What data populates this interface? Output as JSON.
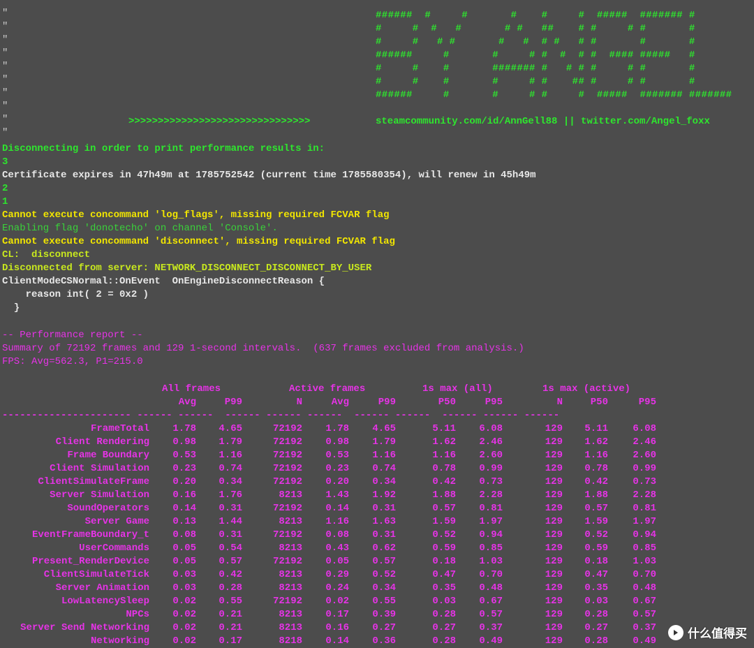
{
  "colors": {
    "background": "#4c4c4c",
    "green": "#2ee62e",
    "white": "#e8e8e8",
    "yellow": "#f2e600",
    "magenta": "#e633e6"
  },
  "banner": {
    "quote_char": "\"",
    "rows": [
      "######  #     #       #    #     #  #####  ####### #",
      "#     #  #   #       # #   ##    # #     # #       #",
      "#     #   # #       #   #  # #   # #       #       #",
      "######     #       #     # #  #  # #  #### #####   #",
      "#     #    #       ####### #   # # #     # #       #",
      "#     #    #       #     # #    ## #     # #       #",
      "######     #       #     # #     #  #####  ####### #######"
    ],
    "arrows": ">>>>>>>>>>>>>>>>>>>>>>>>>>>>>>>",
    "links": "steamcommunity.com/id/AnnGell88 || twitter.com/Angel_foxx"
  },
  "log": {
    "disconnecting": "Disconnecting in order to print performance results in:",
    "count3": "3",
    "certificate": "Certificate expires in 47h49m at 1785752542 (current time 1785580354), will renew in 45h49m",
    "count2": "2",
    "count1": "1",
    "cannot_log_flags": "Cannot execute concommand 'log_flags', missing required FCVAR flag",
    "enabling_flag": "Enabling flag 'donotecho' on channel 'Console'.",
    "cannot_disconnect": "Cannot execute concommand 'disconnect', missing required FCVAR flag",
    "cl_disconnect": "CL:  disconnect",
    "disconnected_from": "Disconnected from server: NETWORK_DISCONNECT_DISCONNECT_BY_USER",
    "client_mode": "ClientModeCSNormal::OnEvent  OnEngineDisconnectReason {",
    "reason": "    reason int( 2 = 0x2 )",
    "close_brace": "  }"
  },
  "performance": {
    "header": "-- Performance report --",
    "summary": "Summary of 72192 frames and 129 1-second intervals.  (637 frames excluded from analysis.)",
    "fps": "FPS: Avg=562.3, P1=215.0",
    "group_headers": {
      "all_frames": "All frames",
      "active_frames": "Active frames",
      "max_all": "1s max (all)",
      "max_active": "1s max (active)"
    },
    "columns": {
      "avg": "Avg",
      "p99": "P99",
      "n": "N",
      "avg2": "Avg",
      "p99_2": "P99",
      "p50": "P50",
      "p95": "P95",
      "n2": "N",
      "p50_2": "P50",
      "p95_2": "P95"
    },
    "rows": [
      [
        "FrameTotal",
        "1.78",
        "4.65",
        "72192",
        "1.78",
        "4.65",
        "5.11",
        "6.08",
        "129",
        "5.11",
        "6.08"
      ],
      [
        "Client Rendering",
        "0.98",
        "1.79",
        "72192",
        "0.98",
        "1.79",
        "1.62",
        "2.46",
        "129",
        "1.62",
        "2.46"
      ],
      [
        "Frame Boundary",
        "0.53",
        "1.16",
        "72192",
        "0.53",
        "1.16",
        "1.16",
        "2.60",
        "129",
        "1.16",
        "2.60"
      ],
      [
        "Client Simulation",
        "0.23",
        "0.74",
        "72192",
        "0.23",
        "0.74",
        "0.78",
        "0.99",
        "129",
        "0.78",
        "0.99"
      ],
      [
        "ClientSimulateFrame",
        "0.20",
        "0.34",
        "72192",
        "0.20",
        "0.34",
        "0.42",
        "0.73",
        "129",
        "0.42",
        "0.73"
      ],
      [
        "Server Simulation",
        "0.16",
        "1.76",
        "8213",
        "1.43",
        "1.92",
        "1.88",
        "2.28",
        "129",
        "1.88",
        "2.28"
      ],
      [
        "SoundOperators",
        "0.14",
        "0.31",
        "72192",
        "0.14",
        "0.31",
        "0.57",
        "0.81",
        "129",
        "0.57",
        "0.81"
      ],
      [
        "Server Game",
        "0.13",
        "1.44",
        "8213",
        "1.16",
        "1.63",
        "1.59",
        "1.97",
        "129",
        "1.59",
        "1.97"
      ],
      [
        "EventFrameBoundary_t",
        "0.08",
        "0.31",
        "72192",
        "0.08",
        "0.31",
        "0.52",
        "0.94",
        "129",
        "0.52",
        "0.94"
      ],
      [
        "UserCommands",
        "0.05",
        "0.54",
        "8213",
        "0.43",
        "0.62",
        "0.59",
        "0.85",
        "129",
        "0.59",
        "0.85"
      ],
      [
        "Present_RenderDevice",
        "0.05",
        "0.57",
        "72192",
        "0.05",
        "0.57",
        "0.18",
        "1.03",
        "129",
        "0.18",
        "1.03"
      ],
      [
        "ClientSimulateTick",
        "0.03",
        "0.42",
        "8213",
        "0.29",
        "0.52",
        "0.47",
        "0.70",
        "129",
        "0.47",
        "0.70"
      ],
      [
        "Server Animation",
        "0.03",
        "0.28",
        "8213",
        "0.24",
        "0.34",
        "0.35",
        "0.48",
        "129",
        "0.35",
        "0.48"
      ],
      [
        "LowLatencySleep",
        "0.02",
        "0.55",
        "72192",
        "0.02",
        "0.55",
        "0.03",
        "0.67",
        "129",
        "0.03",
        "0.67"
      ],
      [
        "NPCs",
        "0.02",
        "0.21",
        "8213",
        "0.17",
        "0.39",
        "0.28",
        "0.57",
        "129",
        "0.28",
        "0.57"
      ],
      [
        "Server Send Networking",
        "0.02",
        "0.21",
        "8213",
        "0.16",
        "0.27",
        "0.27",
        "0.37",
        "129",
        "0.27",
        "0.37"
      ],
      [
        "Networking",
        "0.02",
        "0.17",
        "8218",
        "0.14",
        "0.36",
        "0.28",
        "0.49",
        "129",
        "0.28",
        "0.49"
      ]
    ]
  },
  "watermark": {
    "text": "什么值得买",
    "icon": "value-logo-icon"
  }
}
